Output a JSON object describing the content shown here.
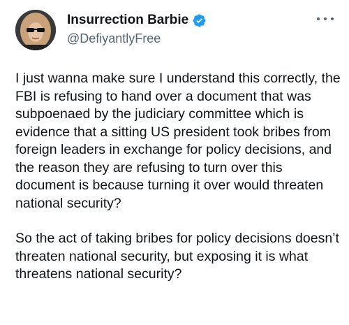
{
  "tweet": {
    "author": {
      "display_name": "Insurrection Barbie",
      "handle": "@DefiyantlyFree",
      "verified": true,
      "avatar_icon": "avatar-portrait-sunglasses",
      "verified_color": "#1d9bf0"
    },
    "more_icon": "more-horizontal-icon",
    "body": {
      "paragraph_1": "I just wanna make sure I understand this correctly, the FBI is refusing to hand over a document that was subpoenaed by the judiciary committee which is evidence that a sitting US president took bribes from foreign leaders in exchange for policy decisions, and the reason they are refusing to turn over this document is because turning it over would threaten national security?",
      "paragraph_2": "So the act of taking bribes for policy decisions doesn’t threaten national security, but exposing it is what threatens national security?"
    }
  }
}
